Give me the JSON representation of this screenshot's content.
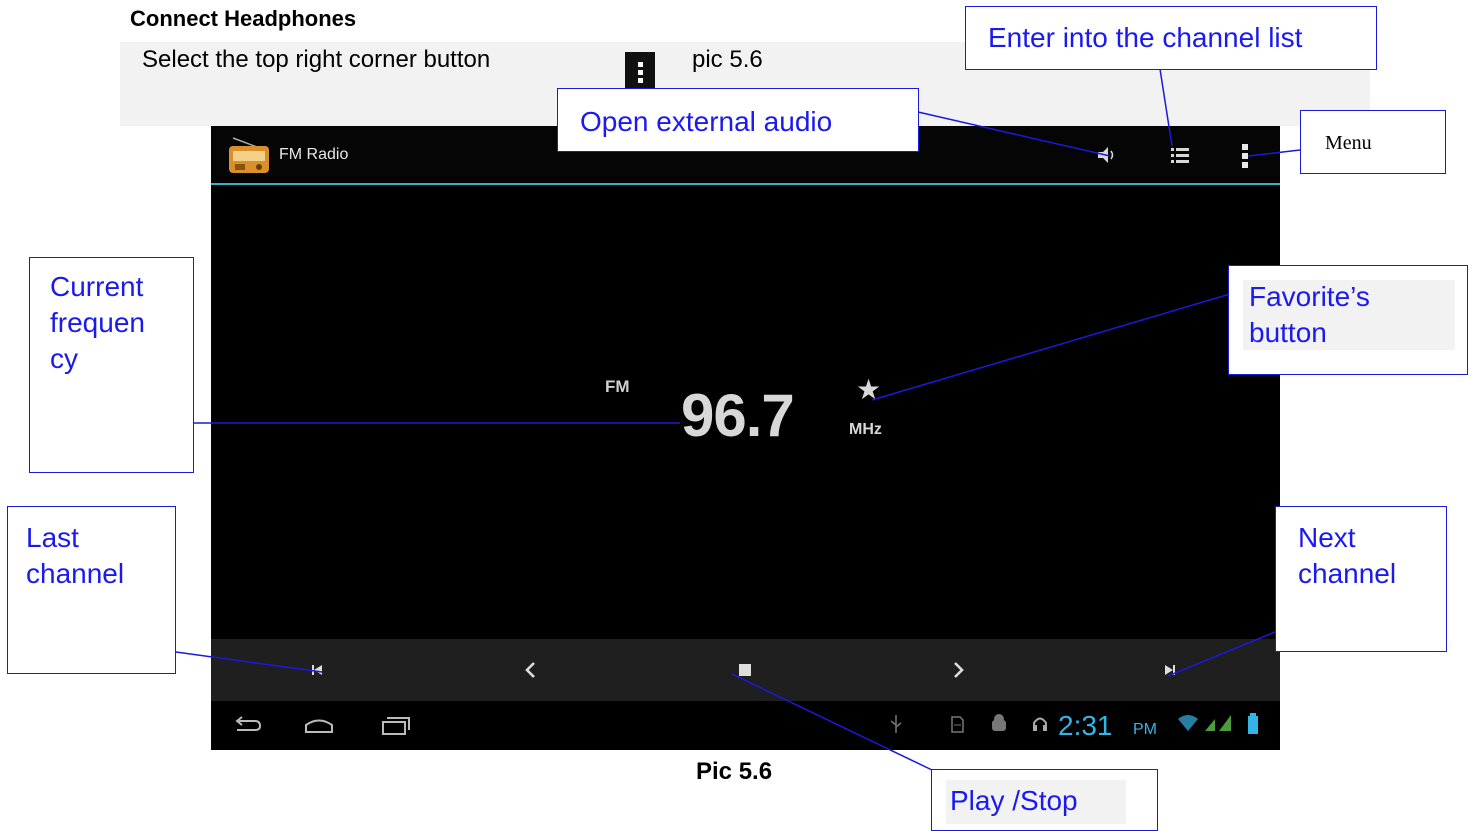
{
  "document": {
    "heading": "Connect Headphones",
    "instruction": "Select the top right corner button",
    "instruction_ref": "pic 5.6",
    "caption": "Pic 5.6"
  },
  "app": {
    "title": "FM Radio",
    "band": "FM",
    "frequency": "96.7",
    "unit": "MHz",
    "accent_color": "#33b5c9",
    "actions": [
      "speaker-icon",
      "list-icon",
      "overflow-menu-icon"
    ],
    "controls": [
      "previous-station-icon",
      "seek-back-icon",
      "stop-icon",
      "seek-forward-icon",
      "next-station-icon"
    ]
  },
  "system_bar": {
    "time": "2:31",
    "ampm": "PM",
    "clock_color": "#33b5e5",
    "icons": [
      "back-icon",
      "home-icon",
      "recent-apps-icon",
      "usb-icon",
      "sd-card-icon",
      "android-icon",
      "headset-icon",
      "wifi-icon",
      "signal-icon",
      "battery-icon"
    ]
  },
  "callouts": {
    "channel_list": "Enter into the channel list",
    "external_audio": "Open external audio",
    "menu": "Menu",
    "current_frequency": [
      "Current",
      "frequen",
      "cy"
    ],
    "favorites": [
      "Favorite’s",
      "button"
    ],
    "last_channel": [
      "Last",
      "channel"
    ],
    "next_channel": [
      "Next",
      "channel"
    ],
    "play_stop": "Play /Stop",
    "callout_color": "#1a1af0"
  }
}
